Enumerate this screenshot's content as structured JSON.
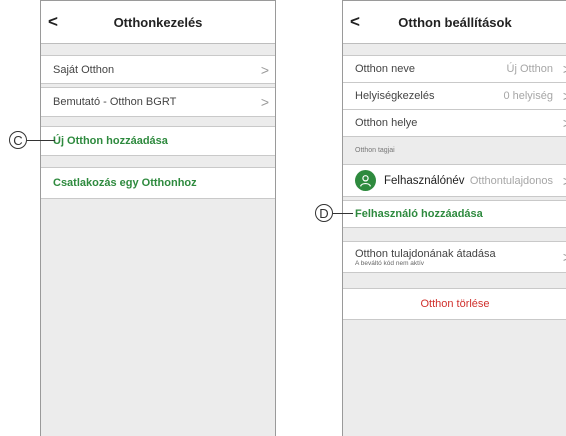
{
  "screen1": {
    "back_icon": "chevron-left-icon",
    "title": "Otthonkezelés",
    "items": [
      {
        "label": "Saját Otthon"
      },
      {
        "label": "Bemutató - Otthon BGRT"
      }
    ],
    "add_home": "Új Otthon hozzáadása",
    "join_home": "Csatlakozás egy Otthonhoz"
  },
  "screen2": {
    "back_icon": "chevron-left-icon",
    "title": "Otthon beállítások",
    "rows": [
      {
        "label": "Otthon neve",
        "value": "Új Otthon"
      },
      {
        "label": "Helyiségkezelés",
        "value": "0 helyiség"
      },
      {
        "label": "Otthon helye",
        "value": ""
      }
    ],
    "members_section": "Otthon tagjai",
    "user": {
      "name": "Felhasználónév",
      "role": "Otthontulajdonos"
    },
    "add_user": "Felhasználó hozzáadása",
    "transfer": {
      "label": "Otthon tulajdonának átadása",
      "sub": "A beváltó kód nem aktív"
    },
    "delete": "Otthon törlése"
  },
  "callouts": {
    "c": "C",
    "d": "D"
  },
  "colors": {
    "green": "#2e8a3e",
    "red": "#d0302c",
    "background": "#ececec"
  }
}
